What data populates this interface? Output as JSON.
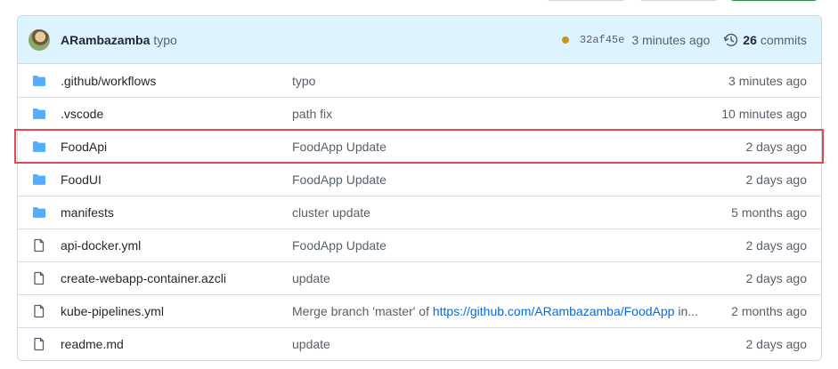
{
  "header": {
    "author": "ARambazamba",
    "message": "typo",
    "sha": "32af45e",
    "time": "3 minutes ago",
    "commit_count": "26",
    "commits_label": "commits"
  },
  "files": [
    {
      "icon": "folder-icon",
      "name": ".github/workflows",
      "message": "typo",
      "age": "3 minutes ago"
    },
    {
      "icon": "folder-icon",
      "name": ".vscode",
      "message": "path fix",
      "age": "10 minutes ago"
    },
    {
      "icon": "folder-icon",
      "name": "FoodApi",
      "message": "FoodApp Update",
      "age": "2 days ago"
    },
    {
      "icon": "folder-icon",
      "name": "FoodUI",
      "message": "FoodApp Update",
      "age": "2 days ago"
    },
    {
      "icon": "folder-icon",
      "name": "manifests",
      "message": "cluster update",
      "age": "5 months ago"
    },
    {
      "icon": "file-icon",
      "name": "api-docker.yml",
      "message": "FoodApp Update",
      "age": "2 days ago"
    },
    {
      "icon": "file-icon",
      "name": "create-webapp-container.azcli",
      "message": "update",
      "age": "2 days ago"
    },
    {
      "icon": "file-icon",
      "name": "kube-pipelines.yml",
      "message_prefix": "Merge branch 'master' of ",
      "message_link": "https://github.com/ARambazamba/FoodApp",
      "message_suffix": " in...",
      "age": "2 months ago"
    },
    {
      "icon": "file-icon",
      "name": "readme.md",
      "message": "update",
      "age": "2 days ago"
    }
  ],
  "colors": {
    "folder": "#54aeff",
    "header_bg": "#ddf4ff",
    "highlight": "#e5484d",
    "link": "#0969da"
  }
}
